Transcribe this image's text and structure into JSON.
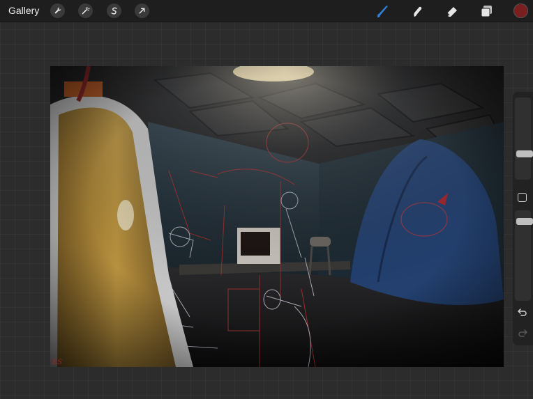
{
  "topbar": {
    "gallery_label": "Gallery",
    "left_tools": [
      "wrench-icon",
      "magic-wand-icon",
      "selection-icon",
      "transform-arrow-icon"
    ],
    "right_tools": [
      "brush-icon",
      "smudge-icon",
      "eraser-icon",
      "layers-icon"
    ],
    "active_tool": "brush-icon",
    "current_color": "#7a1f1f",
    "accent_color": "#2f7fd6"
  },
  "sidebar": {
    "brush_size_level": 0.7,
    "opacity_level": 0.9
  },
  "canvas": {
    "signature": "ES"
  }
}
